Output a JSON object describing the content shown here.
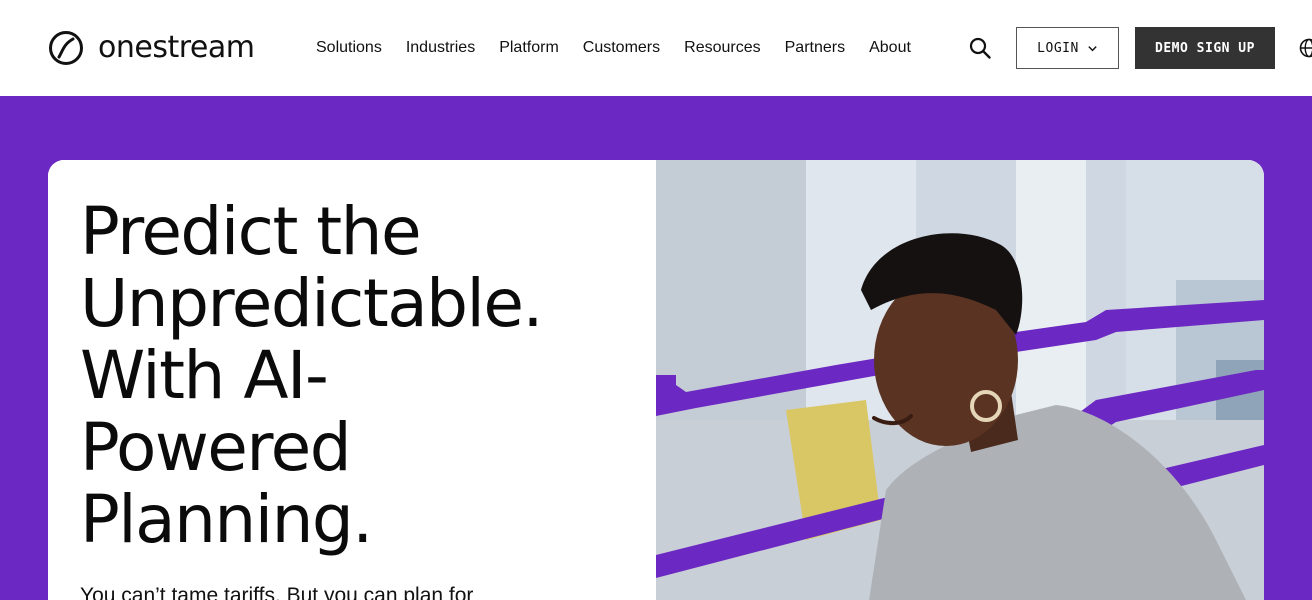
{
  "brand": {
    "name": "onestream"
  },
  "nav": {
    "items": [
      {
        "label": "Solutions"
      },
      {
        "label": "Industries"
      },
      {
        "label": "Platform"
      },
      {
        "label": "Customers"
      },
      {
        "label": "Resources"
      },
      {
        "label": "Partners"
      },
      {
        "label": "About"
      }
    ]
  },
  "actions": {
    "login_label": "LOGIN",
    "demo_label": "DEMO SIGN UP"
  },
  "hero": {
    "headline_lines": [
      "Predict the",
      "Unpredictable.",
      "With AI-",
      "Powered",
      "Planning."
    ],
    "subtext": "You can’t tame tariffs. But you can plan for"
  },
  "icons": {
    "search": "search-icon",
    "chevron": "chevron-down-icon",
    "globe": "globe-icon",
    "logo": "onestream-logo-icon"
  },
  "colors": {
    "hero_bg": "#6c28c2",
    "demo_button": "#333333",
    "text": "#111111"
  }
}
